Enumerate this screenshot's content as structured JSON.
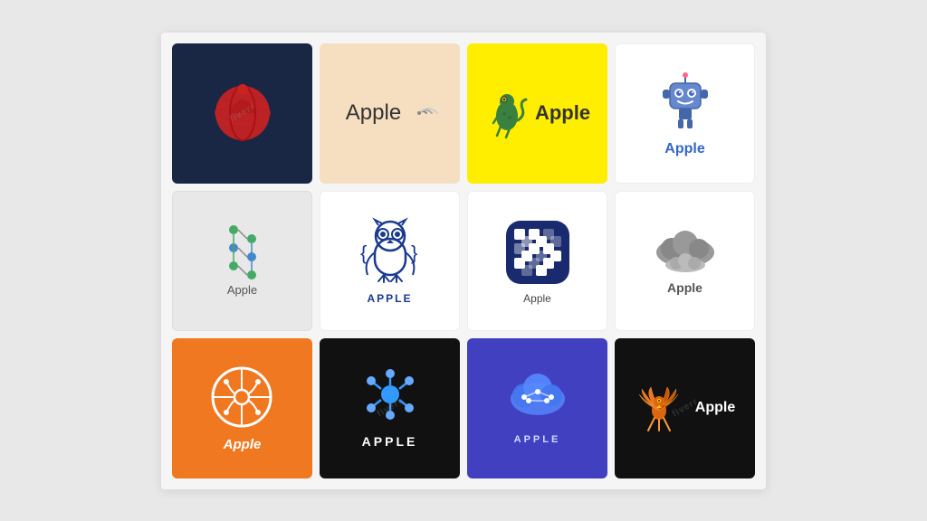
{
  "grid": {
    "cells": [
      {
        "id": 1,
        "bg": "#1a2744",
        "label": "",
        "style": "dark-globe"
      },
      {
        "id": 2,
        "bg": "#f5dfc0",
        "label": "Apple",
        "style": "beige-wifi"
      },
      {
        "id": 3,
        "bg": "#ffee00",
        "label": "Apple",
        "style": "yellow-chameleon"
      },
      {
        "id": 4,
        "bg": "#ffffff",
        "label": "Apple",
        "style": "white-robot"
      },
      {
        "id": 5,
        "bg": "#e8e8e8",
        "label": "Apple",
        "style": "gray-dna"
      },
      {
        "id": 6,
        "bg": "#ffffff",
        "label": "APPLE",
        "style": "white-owl"
      },
      {
        "id": 7,
        "bg": "#ffffff",
        "label": "Apple",
        "style": "white-pattern"
      },
      {
        "id": 8,
        "bg": "#ffffff",
        "label": "Apple",
        "style": "white-cloud"
      },
      {
        "id": 9,
        "bg": "#f07820",
        "label": "Apple",
        "style": "orange-circuit"
      },
      {
        "id": 10,
        "bg": "#111111",
        "label": "APPLE",
        "style": "black-molecule"
      },
      {
        "id": 11,
        "bg": "#4040c0",
        "label": "APPLE",
        "style": "purple-cloudnet"
      },
      {
        "id": 12,
        "bg": "#111111",
        "label": "Apple",
        "style": "black-phoenix"
      }
    ]
  }
}
